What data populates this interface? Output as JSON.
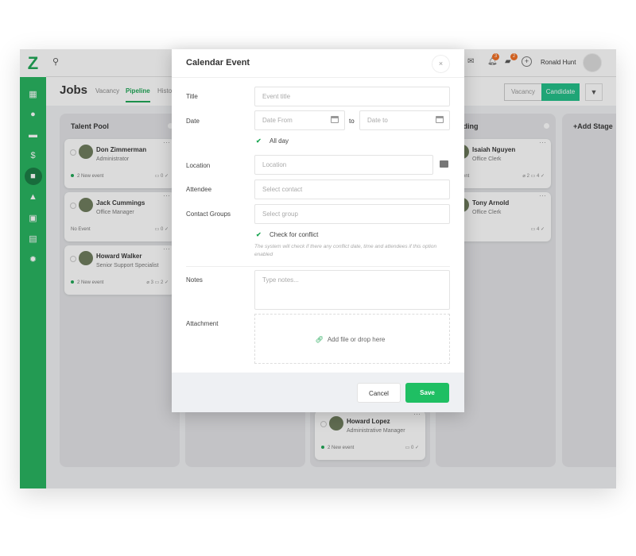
{
  "app": {
    "title": "Jobs",
    "user": "Ronald Hunt",
    "notif_count": "3",
    "msg_count": "2",
    "tabs": [
      "Vacancy",
      "Pipeline",
      "Histo"
    ],
    "active_tab": "Pipeline",
    "view_toggle": [
      "Vacancy",
      "Candidate"
    ],
    "accent": "#1aa552",
    "sidebar_icons": [
      "dashboard-icon",
      "user-icon",
      "chat-icon",
      "dollar-icon",
      "briefcase-icon",
      "building-icon",
      "contact-icon",
      "calendar-icon",
      "gear-icon"
    ],
    "columns": [
      {
        "title": "Talent Pool",
        "cards": [
          {
            "name": "Don Zimmerman",
            "role": "Administrator",
            "event": "2  New event",
            "dot": true,
            "meta": "▭ 0  ✓"
          },
          {
            "name": "Jack Cummings",
            "role": "Office Manager",
            "event": "No Event",
            "dot": false,
            "meta": "▭ 0  ✓"
          },
          {
            "name": "Howard Walker",
            "role": "Senior Support Specialist",
            "event": "2  New event",
            "dot": true,
            "meta": "⌀ 3  ▭ 2  ✓"
          }
        ]
      },
      {
        "title": "",
        "cards": []
      },
      {
        "title": "",
        "cards": [
          {
            "name": "Howard Lopez",
            "role": "Administrative Manager",
            "event": "2  New event",
            "dot": true,
            "meta": "▭ 0  ✓"
          }
        ]
      },
      {
        "title": "Boarding",
        "cards": [
          {
            "name": "Isaiah Nguyen",
            "role": "Office Clerk",
            "event": "New event",
            "dot": false,
            "meta": "⌀ 2  ▭ 4  ✓"
          },
          {
            "name": "Tony Arnold",
            "role": "Office Clerk",
            "event": "Event",
            "dot": false,
            "meta": "▭ 4  ✓"
          }
        ]
      },
      {
        "title": "+Add Stage",
        "cards": []
      }
    ]
  },
  "modal": {
    "title": "Calendar Event",
    "close": "×",
    "labels": {
      "title": "Title",
      "date": "Date",
      "location": "Location",
      "attendee": "Attendee",
      "groups": "Contact Groups",
      "notes": "Notes",
      "attachment": "Attachment"
    },
    "placeholders": {
      "title": "Event title",
      "date_from": "Date From",
      "date_to": "Date to",
      "location": "Location",
      "attendee": "Select contact",
      "groups": "Select group",
      "notes": "Type notes..."
    },
    "to": "to",
    "all_day": "All day",
    "all_day_checked": true,
    "conflict": "Check for conflict",
    "conflict_checked": true,
    "hint": "The system will check if there any conflict date, time and attendees if this option enabled",
    "drop": "Add file or drop here",
    "cancel": "Cancel",
    "save": "Save"
  }
}
